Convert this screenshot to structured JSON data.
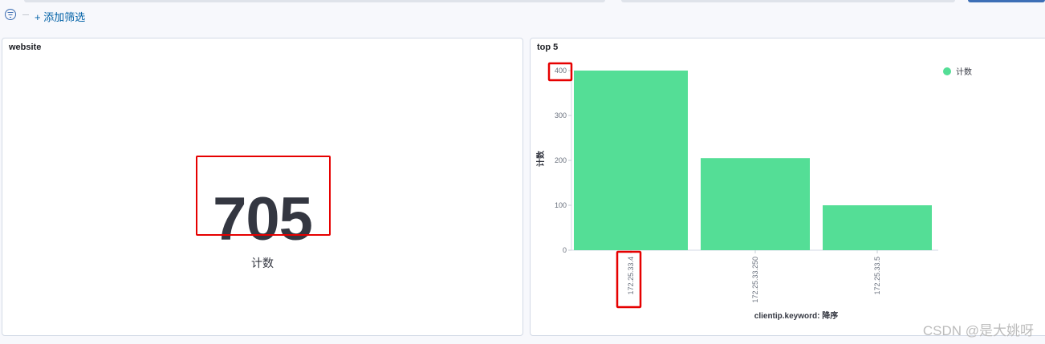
{
  "filter_bar": {
    "add_filter_label": "+ 添加筛选",
    "filter_icon": "filter-icon"
  },
  "panels": {
    "website": {
      "title": "website",
      "metric_value": "705",
      "metric_label": "计数"
    },
    "top5": {
      "title": "top 5",
      "legend_label": "计数",
      "xlabel": "clientip.keyword: 降序",
      "ylabel": "计数"
    }
  },
  "chart_data": {
    "type": "bar",
    "categories": [
      "172.25.33.4",
      "172.25.33.250",
      "172.25.33.5"
    ],
    "series": [
      {
        "name": "计数",
        "values": [
          400,
          205,
          100
        ],
        "color": "#54de96"
      }
    ],
    "xlabel": "clientip.keyword: 降序",
    "ylabel": "计数",
    "ylim": [
      0,
      400
    ],
    "yticks": [
      0,
      100,
      200,
      300,
      400
    ],
    "grid": false,
    "legend": "top-right"
  },
  "colors": {
    "bar": "#54de96",
    "highlight_box": "#e60000",
    "link": "#0061a6"
  },
  "watermark": "CSDN @是大姚呀"
}
